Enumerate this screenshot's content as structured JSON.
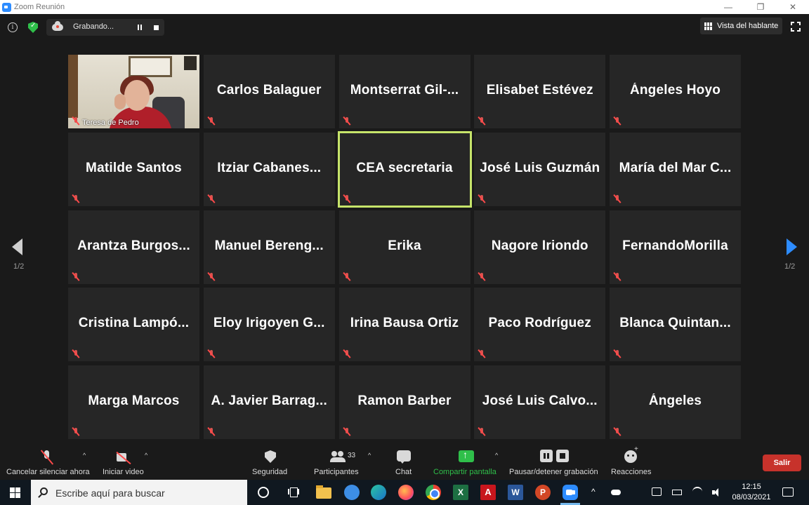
{
  "window": {
    "title": "Zoom Reunión",
    "minimize": "—",
    "restore": "❐",
    "close": "✕"
  },
  "top_bar": {
    "recording_label": "Grabando...",
    "speaker_view_label": "Vista del hablante"
  },
  "participants": [
    {
      "name": "Teresa de Pedro",
      "video": true
    },
    {
      "name": "Carlos Balaguer"
    },
    {
      "name": "Montserrat  Gil-..."
    },
    {
      "name": "Elisabet Estévez"
    },
    {
      "name": "Ángeles Hoyo"
    },
    {
      "name": "Matilde Santos"
    },
    {
      "name": "Itziar  Cabanes..."
    },
    {
      "name": "CEA secretaria",
      "active_speaker": true
    },
    {
      "name": "José Luis Guzmán"
    },
    {
      "name": "María  del  Mar  C..."
    },
    {
      "name": "Arantza  Burgos..."
    },
    {
      "name": "Manuel  Bereng..."
    },
    {
      "name": "Erika"
    },
    {
      "name": "Nagore Iriondo"
    },
    {
      "name": "FernandoMorilla"
    },
    {
      "name": "Cristina  Lampó..."
    },
    {
      "name": "Eloy  Irigoyen  G..."
    },
    {
      "name": "Irina Bausa Ortiz"
    },
    {
      "name": "Paco Rodríguez"
    },
    {
      "name": "Blanca  Quintan..."
    },
    {
      "name": "Marga Marcos"
    },
    {
      "name": "A.  Javier  Barrag..."
    },
    {
      "name": "Ramon Barber"
    },
    {
      "name": "José  Luis  Calvo..."
    },
    {
      "name": "Ángeles"
    }
  ],
  "pagination": {
    "left": "1/2",
    "right": "1/2"
  },
  "toolbar": {
    "unmute_label": "Cancelar silenciar ahora",
    "video_label": "Iniciar video",
    "security_label": "Seguridad",
    "participants_label": "Participantes",
    "participants_count": "33",
    "chat_label": "Chat",
    "share_label": "Compartir pantalla",
    "recording_control_label": "Pausar/detener grabación",
    "reactions_label": "Reacciones",
    "leave_label": "Salir",
    "caret": "^"
  },
  "colors": {
    "share_green": "#2fbf4a",
    "active_border": "#c6e46a",
    "leave_red": "#c7322b",
    "accent_blue": "#2d8cff"
  },
  "taskbar": {
    "search_placeholder": "Escribe aquí para buscar",
    "excel_letter": "X",
    "acrobat_letter": "A",
    "word_letter": "W",
    "ppt_letter": "P",
    "tray_caret": "^",
    "time": "12:15",
    "date": "08/03/2021"
  }
}
